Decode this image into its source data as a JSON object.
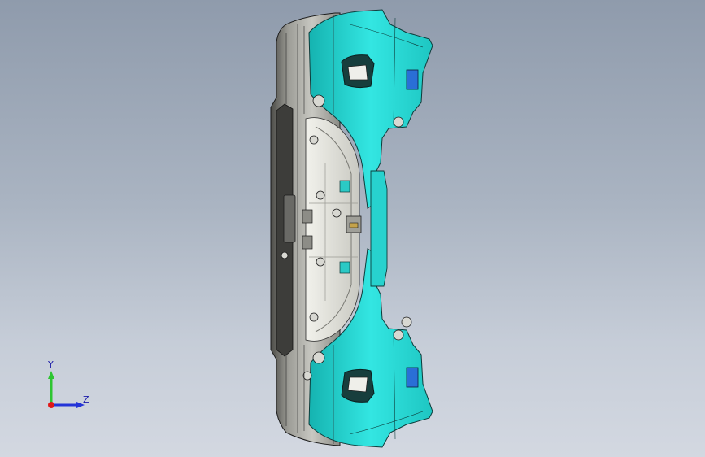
{
  "viewport": {
    "background_top": "#8f9bac",
    "background_bottom": "#d3d8e1"
  },
  "model": {
    "part_colors": {
      "cyan_surface": "#2fe0dc",
      "cyan_dark": "#12a9a6",
      "gray_surface": "#a9a9a4",
      "gray_light": "#e2e2dc",
      "gray_dark": "#3a3a3a",
      "edge": "#1c1c1c"
    }
  },
  "triad": {
    "y_axis_label": "Y",
    "z_axis_label": "Z",
    "y_color": "#2ec531",
    "z_color": "#2434d8",
    "origin_color": "#e01818"
  }
}
